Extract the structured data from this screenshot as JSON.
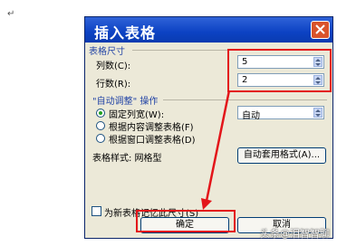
{
  "document": {
    "paragraph_mark": "↵"
  },
  "dialog": {
    "title": "插入表格",
    "table_size_section": "表格尺寸",
    "columns_label": "列数(C):",
    "columns_value": "5",
    "rows_label": "行数(R):",
    "rows_value": "2",
    "autofit_section": "\"自动调整\" 操作",
    "autofit_options": [
      {
        "label": "固定列宽(W):",
        "checked": true
      },
      {
        "label": "根据内容调整表格(F)",
        "checked": false
      },
      {
        "label": "根据窗口调整表格(D)",
        "checked": false
      }
    ],
    "column_width_value": "自动",
    "table_style_label": "表格样式: 网格型",
    "autoformat_button": "自动套用格式(A)...",
    "remember_checkbox_label": "为新表格记忆此尺寸(S)",
    "remember_checked": false,
    "ok_button": "确定",
    "cancel_button": "取消"
  },
  "annotations": {
    "highlight_color": "#e3151a"
  },
  "watermark": "头条@泪智智聊"
}
